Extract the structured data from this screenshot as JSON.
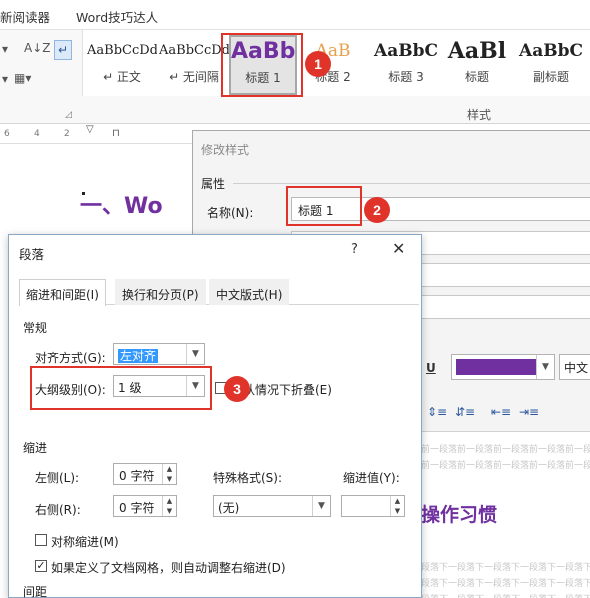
{
  "ribbon": {
    "menu_items": [
      "新阅读器",
      "Word技巧达人"
    ],
    "sort_icon": "sort-az-icon",
    "show_marks_icon": "paragraph-mark-icon",
    "styles_caption": "样式",
    "styles": [
      {
        "sample": "AaBbCcDd",
        "label": "↵ 正文"
      },
      {
        "sample": "AaBbCcDd",
        "label": "↵ 无间隔"
      },
      {
        "sample": "AaBb",
        "label": "标题 1"
      },
      {
        "sample": "AaB",
        "label": "标题 2"
      },
      {
        "sample": "AaBbC",
        "label": "标题 3"
      },
      {
        "sample": "AaBl",
        "label": "标题"
      },
      {
        "sample": "AaBbC",
        "label": "副标题"
      }
    ]
  },
  "document": {
    "ruler_marks": [
      "6",
      "4",
      "2"
    ],
    "heading_text": "一、Wo"
  },
  "modify_dialog": {
    "title": "修改样式",
    "section_properties": "属性",
    "name_label": "名称(N):",
    "name_value": "标题 1",
    "underline_label": "U",
    "font_color": "#7030a0",
    "language_value": "中文",
    "preview_before_line": "前一段落前一段落前一段落前一段落前一段",
    "preview_heading": "操作习惯",
    "preview_after_line": "段落下一段落下一段落下一段落下一段落下"
  },
  "paragraph_dialog": {
    "title": "段落",
    "help_label": "?",
    "close_label": "✕",
    "tabs": [
      "缩进和间距(I)",
      "换行和分页(P)",
      "中文版式(H)"
    ],
    "general_section": "常规",
    "alignment_label": "对齐方式(G):",
    "alignment_value": "左对齐",
    "outline_label": "大纲级别(O):",
    "outline_value": "1 级",
    "collapse_label": "默认情况下折叠(E)",
    "indent_section": "缩进",
    "left_label": "左侧(L):",
    "left_value": "0 字符",
    "right_label": "右侧(R):",
    "right_value": "0 字符",
    "special_label": "特殊格式(S):",
    "special_value": "(无)",
    "indent_by_label": "缩进值(Y):",
    "indent_by_value": "",
    "mirror_label": "对称缩进(M)",
    "mirror_checked": false,
    "auto_adjust_label": "如果定义了文档网格，则自动调整右缩进(D)",
    "auto_adjust_checked": true,
    "spacing_section": "间距"
  },
  "callouts": {
    "one": "1",
    "two": "2",
    "three": "3",
    "color": "#e0342b"
  }
}
